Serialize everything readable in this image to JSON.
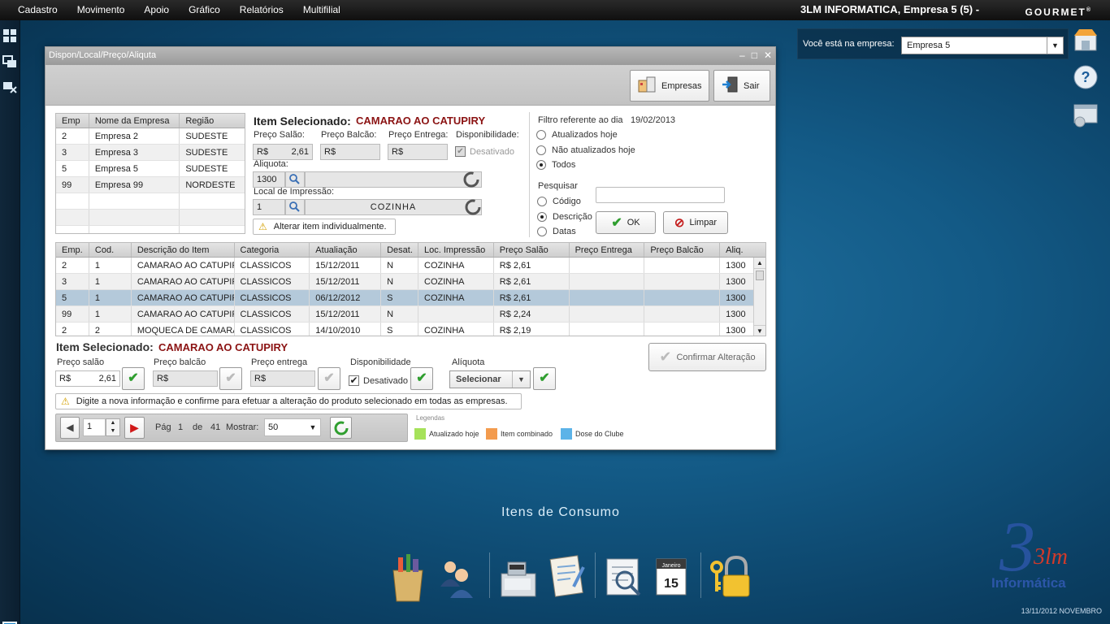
{
  "menu": [
    "Cadastro",
    "Movimento",
    "Apoio",
    "Gráfico",
    "Relatórios",
    "Multifilial"
  ],
  "header": {
    "company": "3LM INFORMATICA,  Empresa 5 (5) -",
    "brand": "GOURMET",
    "brand_mark": "®"
  },
  "empresa": {
    "label": "Você está na empresa:",
    "value": "Empresa 5"
  },
  "window": {
    "title": "Dispon/Local/Preço/Aliquta",
    "toolbar": {
      "empresas": "Empresas",
      "sair": "Sair"
    },
    "emp_grid": {
      "headers": [
        "Emp",
        "Nome da Empresa",
        "Região"
      ],
      "rows": [
        [
          "2",
          "Empresa 2",
          "SUDESTE"
        ],
        [
          "3",
          "Empresa 3",
          "SUDESTE"
        ],
        [
          "5",
          "Empresa 5",
          "SUDESTE"
        ],
        [
          "99",
          "Empresa 99",
          "NORDESTE"
        ],
        [
          "",
          "",
          ""
        ],
        [
          "",
          "",
          ""
        ],
        [
          "",
          "",
          ""
        ]
      ]
    },
    "item": {
      "label": "Item Selecionado:",
      "value": "CAMARAO AO CATUPIRY",
      "preco_salao_lbl": "Preço Salão:",
      "preco_balcao_lbl": "Preço Balcão:",
      "preco_entrega_lbl": "Preço Entrega:",
      "disp_lbl": "Disponibilidade:",
      "currency": "R$",
      "preco_salao": "2,61",
      "desativado": "Desativado",
      "aliquota_lbl": "Aliquota:",
      "aliquota": "1300",
      "local_lbl": "Local de Impressão:",
      "local_code": "1",
      "local_name": "COZINHA",
      "alterar": "Alterar item individualmente."
    },
    "filtro": {
      "label": "Filtro referente ao dia",
      "date": "19/02/2013",
      "options": [
        "Atualizados hoje",
        "Não atualizados hoje",
        "Todos"
      ],
      "pesquisar": "Pesquisar",
      "search_opts": [
        "Código",
        "Descrição",
        "Datas"
      ],
      "ok": "OK",
      "limpar": "Limpar"
    },
    "items_grid": {
      "headers": [
        "Emp.",
        "Cod.",
        "Descrição do Item",
        "Categoria",
        "Atualiação",
        "Desat.",
        "Loc. Impressão",
        "Preço Salão",
        "Preço Entrega",
        "Preço Balcão",
        "Aliq."
      ],
      "rows": [
        [
          "2",
          "1",
          "CAMARAO AO CATUPIRY",
          "CLASSICOS",
          "15/12/2011",
          "N",
          "COZINHA",
          "R$ 2,61",
          "",
          "",
          "1300"
        ],
        [
          "3",
          "1",
          "CAMARAO AO CATUPIRY",
          "CLASSICOS",
          "15/12/2011",
          "N",
          "COZINHA",
          "R$ 2,61",
          "",
          "",
          "1300"
        ],
        [
          "5",
          "1",
          "CAMARAO AO CATUPIRY",
          "CLASSICOS",
          "06/12/2012",
          "S",
          "COZINHA",
          "R$ 2,61",
          "",
          "",
          "1300"
        ],
        [
          "99",
          "1",
          "CAMARAO AO CATUPIRY",
          "CLASSICOS",
          "15/12/2011",
          "N",
          "",
          "R$ 2,24",
          "",
          "",
          "1300"
        ],
        [
          "2",
          "2",
          "MOQUECA DE CAMARAO",
          "CLASSICOS",
          "14/10/2010",
          "S",
          "COZINHA",
          "R$ 2,19",
          "",
          "",
          "1300"
        ]
      ]
    },
    "edit": {
      "label": "Item Selecionado:",
      "value": "CAMARAO AO CATUPIRY",
      "preco_salao": "Preço salão",
      "preco_balcao": "Preço balcão",
      "preco_entrega": "Preço entrega",
      "disponibilidade": "Disponibilidade",
      "aliquota": "Alíquota",
      "currency": "R$",
      "salao_value": "2,61",
      "desativado": "Desativado",
      "selecionar": "Selecionar",
      "confirmar": "Confirmar Alteração",
      "info": "Digite a nova informação e confirme para efetuar a alteração do produto selecionado em todas as empresas."
    },
    "pager": {
      "page": "1",
      "pag": "Pág",
      "current": "1",
      "de": "de",
      "total": "41",
      "mostrar": "Mostrar:",
      "per_page": "50"
    },
    "legend": {
      "title": "Legendas",
      "items": [
        {
          "label": "Atualizado hoje",
          "color": "#a6e25a"
        },
        {
          "label": "Item combinado",
          "color": "#f39b4e"
        },
        {
          "label": "Dose do Clube",
          "color": "#5cb3e8"
        }
      ]
    }
  },
  "dock": {
    "title": "Itens de Consumo"
  },
  "logo": {
    "big": "3lm",
    "sub": "Informática"
  },
  "statusbar": {
    "datetime": "13/11/2012 NOVEMBRO"
  }
}
